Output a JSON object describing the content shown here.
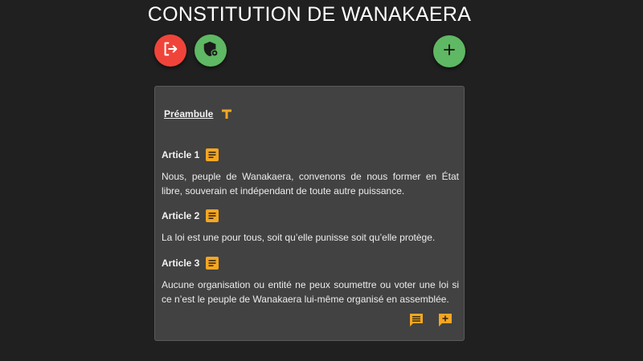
{
  "page": {
    "title": "CONSTITUTION DE WANAKAERA"
  },
  "toolbar": {
    "logout_icon": "logout-icon",
    "admin_icon": "shield-admin-icon",
    "add_icon": "plus-icon",
    "add_label": "+"
  },
  "preamble": {
    "label": "Préambule",
    "icon": "text-format-icon"
  },
  "articles": [
    {
      "title": "Article 1",
      "icon": "article-note-icon",
      "text": "Nous, peuple de Wanakaera, convenons de nous former en État libre, souverain et indépendant de toute autre puissance."
    },
    {
      "title": "Article 2",
      "icon": "article-note-icon",
      "text": "La loi est une pour tous, soit qu’elle punisse soit qu’elle protège."
    },
    {
      "title": "Article 3",
      "icon": "article-note-icon",
      "text": "Aucune organisation ou entité ne peux soumettre ou voter une loi si ce n’est le peuple de Wanakaera lui-même organisé en assemblée."
    }
  ],
  "actions": {
    "comment_icon": "comment-icon",
    "add_comment_icon": "add-comment-icon"
  },
  "colors": {
    "background": "#202020",
    "card": "#424242",
    "accent_orange": "#f5a623",
    "danger_red": "#f0443a",
    "success_green": "#5fb863"
  }
}
